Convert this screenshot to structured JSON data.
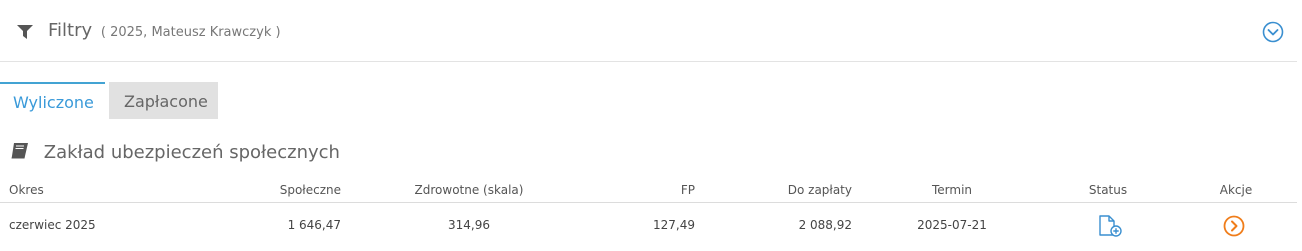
{
  "filters": {
    "title": "Filtry",
    "summary": "( 2025, Mateusz Krawczyk )",
    "icons": {
      "filter": "filter-icon",
      "toggle": "chevron-down-circle-icon"
    }
  },
  "tabs": [
    {
      "label": "Wyliczone",
      "active": true
    },
    {
      "label": "Zapłacone",
      "active": false
    }
  ],
  "section": {
    "title": "Zakład ubezpieczeń społecznych",
    "icon": "book-icon"
  },
  "table": {
    "columns": [
      "Okres",
      "Społeczne",
      "Zdrowotne (skala)",
      "FP",
      "Do zapłaty",
      "Termin",
      "Status",
      "Akcje"
    ],
    "rows": [
      {
        "okres": "czerwiec 2025",
        "spoleczne": "1 646,47",
        "zdrowotne": "314,96",
        "fp": "127,49",
        "do_zaplaty": "2 088,92",
        "termin": "2025-07-21",
        "status_icon": "file-add-icon",
        "action_icon": "arrow-right-circle-icon"
      }
    ]
  },
  "colors": {
    "accent": "#3a9ad9",
    "action": "#f07d1a",
    "tab_inactive_bg": "#e1e1e1"
  }
}
